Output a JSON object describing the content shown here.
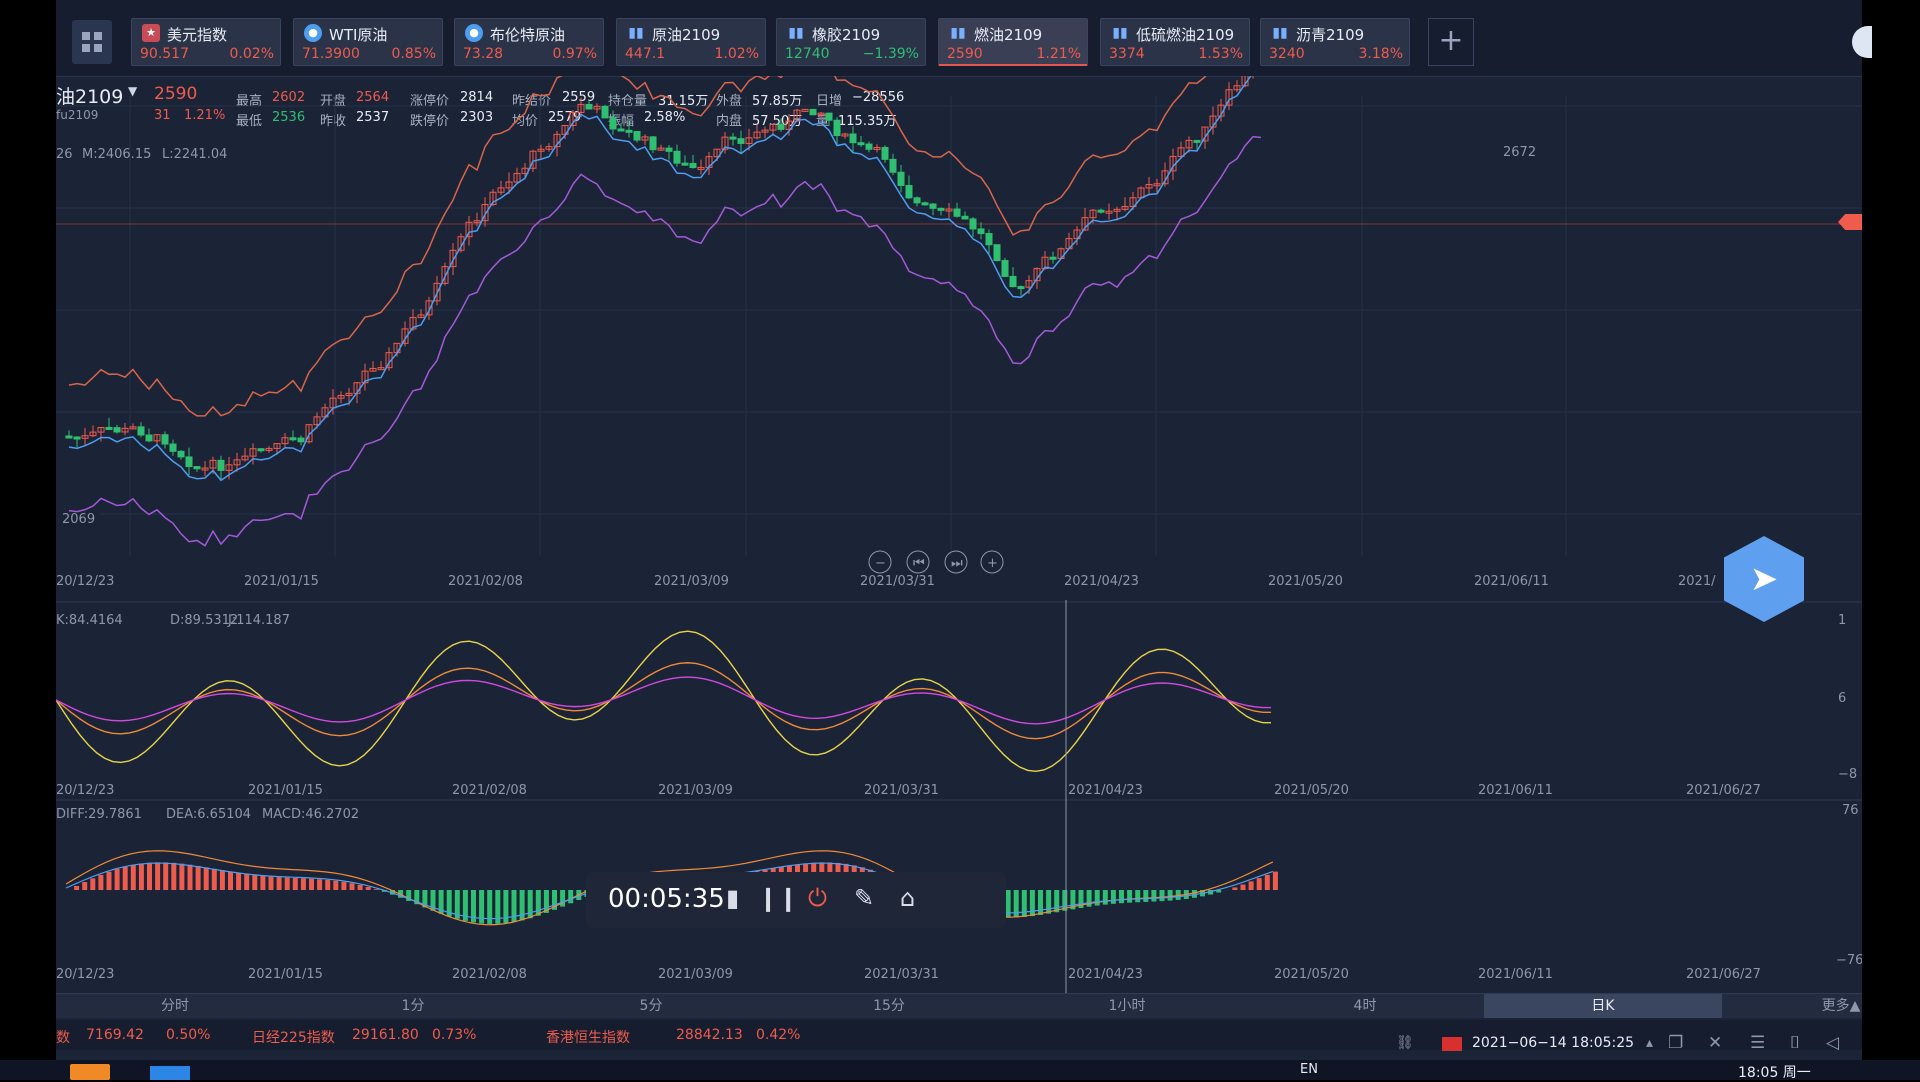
{
  "quote_tabs": [
    {
      "name": "美元指数",
      "price": "90.517",
      "change": "0.02%",
      "icon": "flag-us-icon",
      "dir": "up"
    },
    {
      "name": "WTI原油",
      "price": "71.3900",
      "change": "0.85%",
      "icon": "circle-icon",
      "dir": "up"
    },
    {
      "name": "布伦特原油",
      "price": "73.28",
      "change": "0.97%",
      "icon": "circle-icon",
      "dir": "up"
    },
    {
      "name": "原油2109",
      "price": "447.1",
      "change": "1.02%",
      "icon": "bar-chart-icon",
      "dir": "up"
    },
    {
      "name": "橡胶2109",
      "price": "12740",
      "change": "−1.39%",
      "icon": "bar-chart-icon",
      "dir": "dn"
    },
    {
      "name": "燃油2109",
      "price": "2590",
      "change": "1.21%",
      "icon": "bar-chart-icon",
      "dir": "up",
      "active": true
    },
    {
      "name": "低硫燃油2109",
      "price": "3374",
      "change": "1.53%",
      "icon": "bar-chart-icon",
      "dir": "up"
    },
    {
      "name": "沥青2109",
      "price": "3240",
      "change": "3.18%",
      "icon": "bar-chart-icon",
      "dir": "up"
    }
  ],
  "symbol": {
    "name": "油2109",
    "code": "fu2109",
    "price": "2590",
    "change": "31",
    "change_pct": "1.21%"
  },
  "info_row1": [
    {
      "label": "最高",
      "value": "2602",
      "color": "up"
    },
    {
      "label": "开盘",
      "value": "2564",
      "color": "up"
    },
    {
      "label": "涨停价",
      "value": "2814",
      "color": "val"
    },
    {
      "label": "昨结价",
      "value": "2559",
      "color": "val"
    },
    {
      "label": "持仓量",
      "value": "31.15万",
      "color": "val"
    },
    {
      "label": "外盘",
      "value": "57.85万",
      "color": "val"
    },
    {
      "label": "日增",
      "value": "−28556",
      "color": "val"
    }
  ],
  "info_row2": [
    {
      "label": "最低",
      "value": "2536",
      "color": "dn"
    },
    {
      "label": "昨收",
      "value": "2537",
      "color": "val"
    },
    {
      "label": "跌停价",
      "value": "2303",
      "color": "val"
    },
    {
      "label": "均价",
      "value": "2579",
      "color": "val"
    },
    {
      "label": "振幅",
      "value": "2.58%",
      "color": "val"
    },
    {
      "label": "内盘",
      "value": "57.50万",
      "color": "val"
    },
    {
      "label": "量",
      "value": "115.35万",
      "color": "val"
    }
  ],
  "boll_label": {
    "prefix": "26",
    "mid": "M:2406.15",
    "low": "L:2241.04"
  },
  "kdj_label": {
    "k": "K:84.4164",
    "d": "D:89.5312",
    "j": "J:114.187"
  },
  "macd_label": {
    "diff": "DIFF:29.7861",
    "dea": "DEA:6.65104",
    "macd": "MACD:46.2702"
  },
  "price_markers": {
    "high": "2672",
    "low": "2069"
  },
  "x_dates_main": [
    "20/12/23",
    "2021/01/15",
    "2021/02/08",
    "2021/03/09",
    "2021/03/31",
    "2021/04/23",
    "2021/05/20",
    "2021/06/11",
    "2021/"
  ],
  "x_dates_sub": [
    "20/12/23",
    "2021/01/15",
    "2021/02/08",
    "2021/03/09",
    "2021/03/31",
    "2021/04/23",
    "2021/05/20",
    "2021/06/11",
    "2021/06/27"
  ],
  "kdj_axis": [
    "1",
    "6",
    "−8"
  ],
  "macd_axis": [
    "76",
    "−76"
  ],
  "periods": [
    "分时",
    "1分",
    "5分",
    "15分",
    "1小时",
    "4时",
    "日K",
    "更多▲"
  ],
  "active_period": "日K",
  "ticker": [
    {
      "name": "数",
      "value": "7169.42",
      "pct": "0.50%"
    },
    {
      "name": "日经225指数",
      "value": "29161.80",
      "pct": "0.73%"
    },
    {
      "name": "香港恒生指数",
      "value": "28842.13",
      "pct": "0.42%"
    }
  ],
  "status": {
    "datetime": "2021−06−14 18:05:25",
    "lang": "EN",
    "clock": "18:05 周一"
  },
  "recorder": {
    "time": "00:05:35"
  },
  "colors": {
    "up": "#ef5b4c",
    "down": "#2fbf71",
    "bg": "#1b2336"
  },
  "chart_data": {
    "type": "candlestick",
    "title": "",
    "candles": [],
    "y_range": [
      2069,
      2672
    ]
  }
}
